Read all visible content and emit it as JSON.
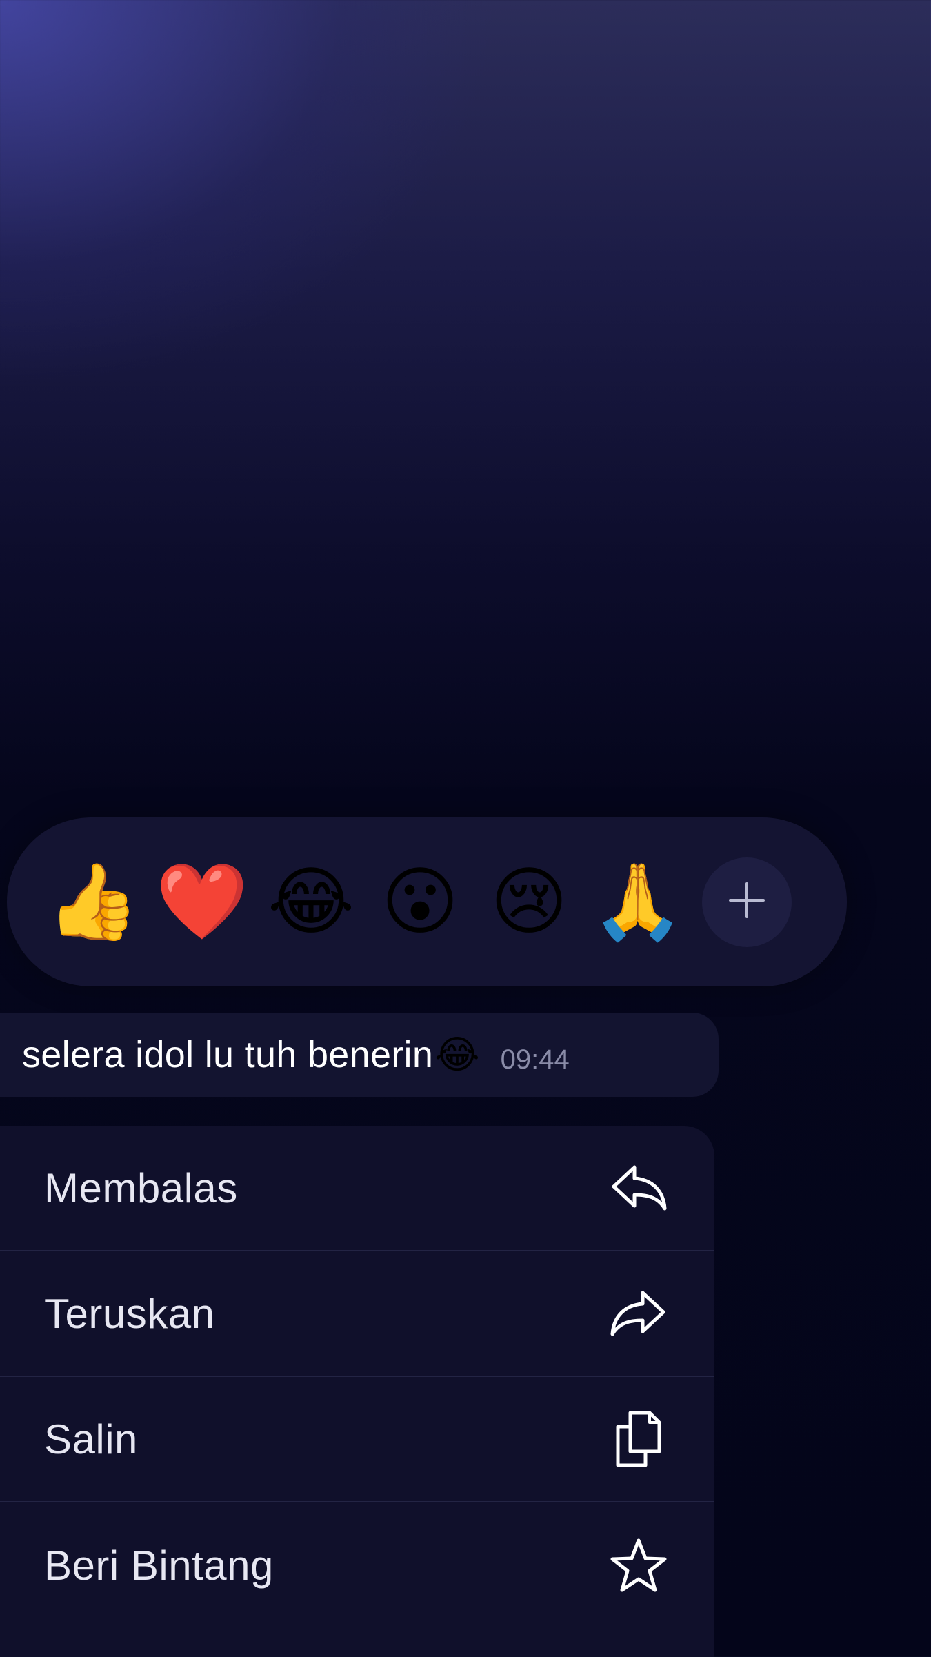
{
  "reactions": {
    "items": [
      {
        "name": "thumbs-up",
        "glyph": "👍"
      },
      {
        "name": "heart",
        "glyph": "❤️"
      },
      {
        "name": "tears-of-joy",
        "glyph": "😂"
      },
      {
        "name": "surprised",
        "glyph": "😮"
      },
      {
        "name": "crying",
        "glyph": "😢"
      },
      {
        "name": "folded-hands",
        "glyph": "🙏"
      }
    ],
    "more_icon": "plus-icon"
  },
  "message": {
    "text": "selera idol lu tuh benerin",
    "emoji": "😂",
    "time": "09:44"
  },
  "menu": {
    "items": [
      {
        "label": "Membalas",
        "icon": "reply-icon"
      },
      {
        "label": "Teruskan",
        "icon": "forward-icon"
      },
      {
        "label": "Salin",
        "icon": "copy-icon"
      },
      {
        "label": "Beri Bintang",
        "icon": "star-icon"
      }
    ]
  },
  "colors": {
    "background_top": "#2c2d5a",
    "background_bottom": "#04051a",
    "panel": "#14152f",
    "text": "#ffffff",
    "time": "#8a8ca8"
  }
}
